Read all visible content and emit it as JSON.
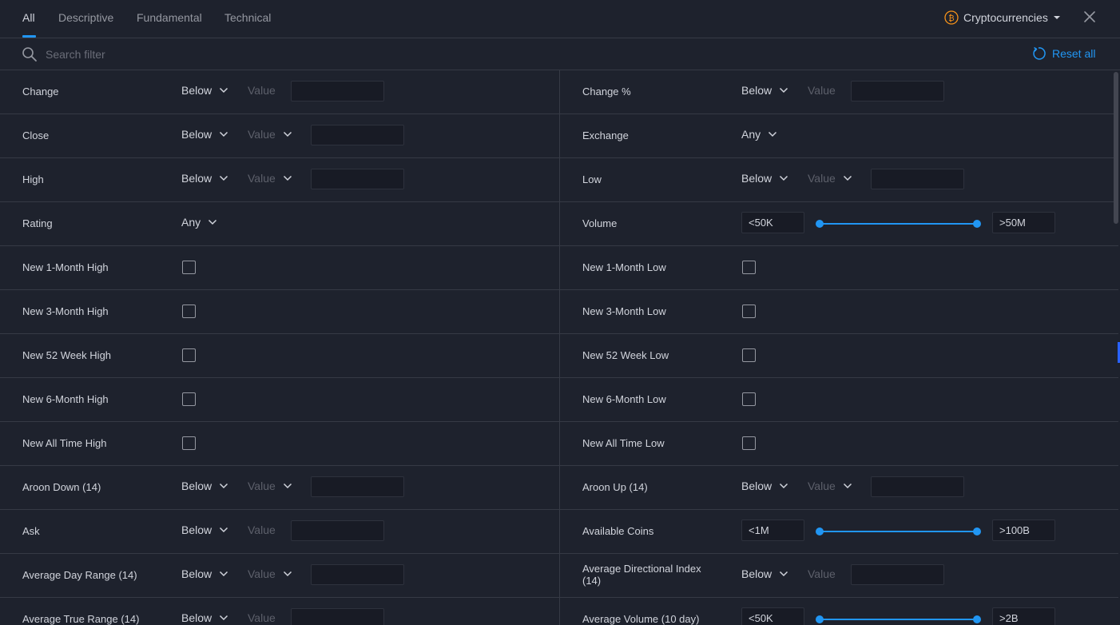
{
  "tabs": [
    "All",
    "Descriptive",
    "Fundamental",
    "Technical"
  ],
  "market": {
    "label": "Cryptocurrencies",
    "icon": "bitcoin-icon",
    "accent": "#f7931a"
  },
  "search": {
    "placeholder": "Search filter"
  },
  "reset": {
    "label": "Reset all"
  },
  "colors": {
    "accent": "#2196f3",
    "background": "#1e222d",
    "border": "#363a45"
  },
  "rows": [
    {
      "left": {
        "label": "Change",
        "op": "Below",
        "value": "Value"
      },
      "right": {
        "label": "Change %",
        "op": "Below",
        "value": "Value"
      }
    },
    {
      "left": {
        "label": "Close",
        "op": "Below",
        "value": "Value"
      },
      "right": {
        "label": "Exchange",
        "op": "Any"
      }
    },
    {
      "left": {
        "label": "High",
        "op": "Below",
        "value": "Value"
      },
      "right": {
        "label": "Low",
        "op": "Below",
        "value": "Value"
      }
    },
    {
      "left": {
        "label": "Rating",
        "op": "Any"
      },
      "right": {
        "label": "Volume",
        "min": "<50K",
        "max": ">50M"
      }
    },
    {
      "left": {
        "label": "New 1-Month High"
      },
      "right": {
        "label": "New 1-Month Low"
      }
    },
    {
      "left": {
        "label": "New 3-Month High"
      },
      "right": {
        "label": "New 3-Month Low"
      }
    },
    {
      "left": {
        "label": "New 52 Week High"
      },
      "right": {
        "label": "New 52 Week Low"
      }
    },
    {
      "left": {
        "label": "New 6-Month High"
      },
      "right": {
        "label": "New 6-Month Low"
      }
    },
    {
      "left": {
        "label": "New All Time High"
      },
      "right": {
        "label": "New All Time Low"
      }
    },
    {
      "left": {
        "label": "Aroon Down (14)",
        "op": "Below",
        "value": "Value"
      },
      "right": {
        "label": "Aroon Up (14)",
        "op": "Below",
        "value": "Value"
      }
    },
    {
      "left": {
        "label": "Ask",
        "op": "Below",
        "value": "Value"
      },
      "right": {
        "label": "Available Coins",
        "min": "<1M",
        "max": ">100B"
      }
    },
    {
      "left": {
        "label": "Average Day Range (14)",
        "op": "Below",
        "value": "Value"
      },
      "right": {
        "label": "Average Directional Index (14)",
        "op": "Below",
        "value": "Value"
      }
    },
    {
      "left": {
        "label": "Average True Range (14)",
        "op": "Below",
        "value": "Value"
      },
      "right": {
        "label": "Average Volume (10 day)",
        "min": "<50K",
        "max": ">2B"
      }
    }
  ]
}
